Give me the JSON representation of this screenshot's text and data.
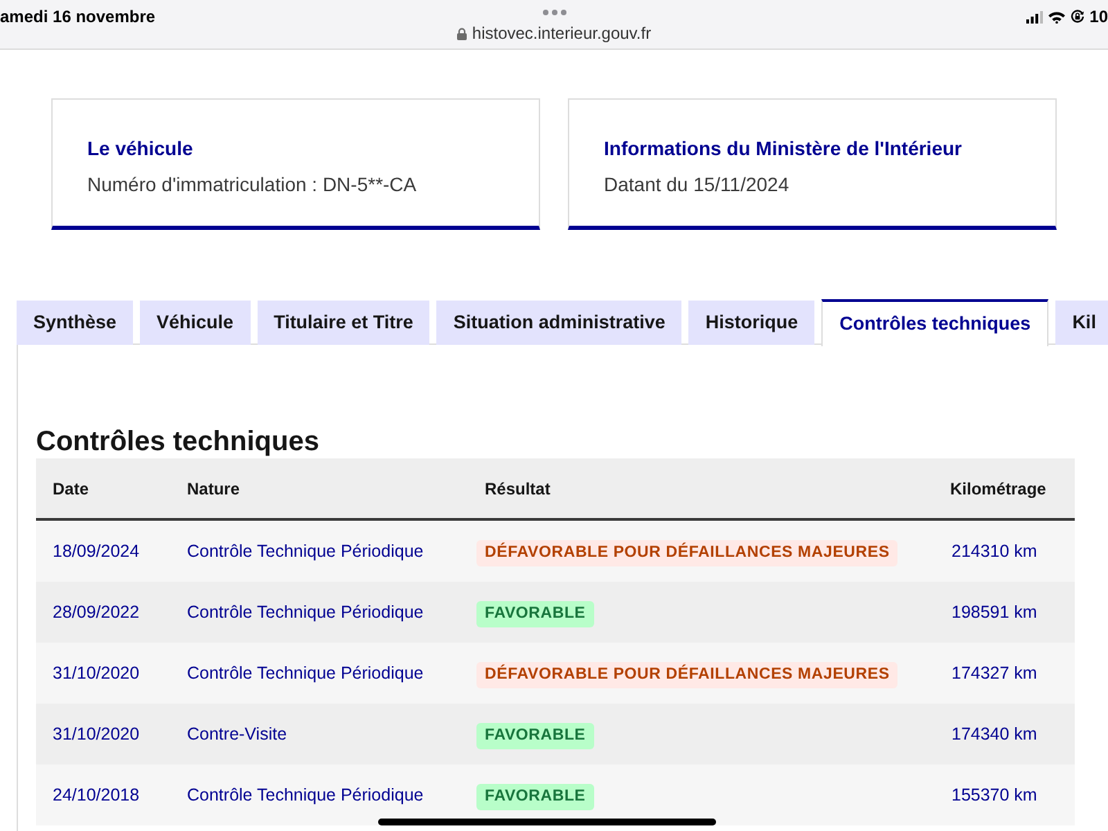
{
  "status_bar": {
    "date": "amedi 16 novembre",
    "url": "histovec.interieur.gouv.fr",
    "right_text": "10"
  },
  "cards": [
    {
      "title": "Le véhicule",
      "text": "Numéro d'immatriculation : DN-5**-CA"
    },
    {
      "title": "Informations du Ministère de l'Intérieur",
      "text": "Datant du 15/11/2024"
    }
  ],
  "tabs": [
    {
      "label": "Synthèse",
      "selected": false
    },
    {
      "label": "Véhicule",
      "selected": false
    },
    {
      "label": "Titulaire et Titre",
      "selected": false
    },
    {
      "label": "Situation administrative",
      "selected": false
    },
    {
      "label": "Historique",
      "selected": false
    },
    {
      "label": "Contrôles techniques",
      "selected": true
    },
    {
      "label": "Kil",
      "selected": false
    }
  ],
  "section": {
    "title": "Contrôles techniques",
    "table": {
      "columns": [
        "Date",
        "Nature",
        "Résultat",
        "Kilométrage"
      ],
      "rows": [
        {
          "date": "18/09/2024",
          "nature": "Contrôle Technique Périodique",
          "result": {
            "label": "DÉFAVORABLE POUR DÉFAILLANCES MAJEURES",
            "kind": "unfavorable"
          },
          "mileage": "214310 km"
        },
        {
          "date": "28/09/2022",
          "nature": "Contrôle Technique Périodique",
          "result": {
            "label": "FAVORABLE",
            "kind": "favorable"
          },
          "mileage": "198591 km"
        },
        {
          "date": "31/10/2020",
          "nature": "Contrôle Technique Périodique",
          "result": {
            "label": "DÉFAVORABLE POUR DÉFAILLANCES MAJEURES",
            "kind": "unfavorable"
          },
          "mileage": "174327 km"
        },
        {
          "date": "31/10/2020",
          "nature": "Contre-Visite",
          "result": {
            "label": "FAVORABLE",
            "kind": "favorable"
          },
          "mileage": "174340 km"
        },
        {
          "date": "24/10/2018",
          "nature": "Contrôle Technique Périodique",
          "result": {
            "label": "FAVORABLE",
            "kind": "favorable"
          },
          "mileage": "155370 km"
        }
      ]
    }
  }
}
